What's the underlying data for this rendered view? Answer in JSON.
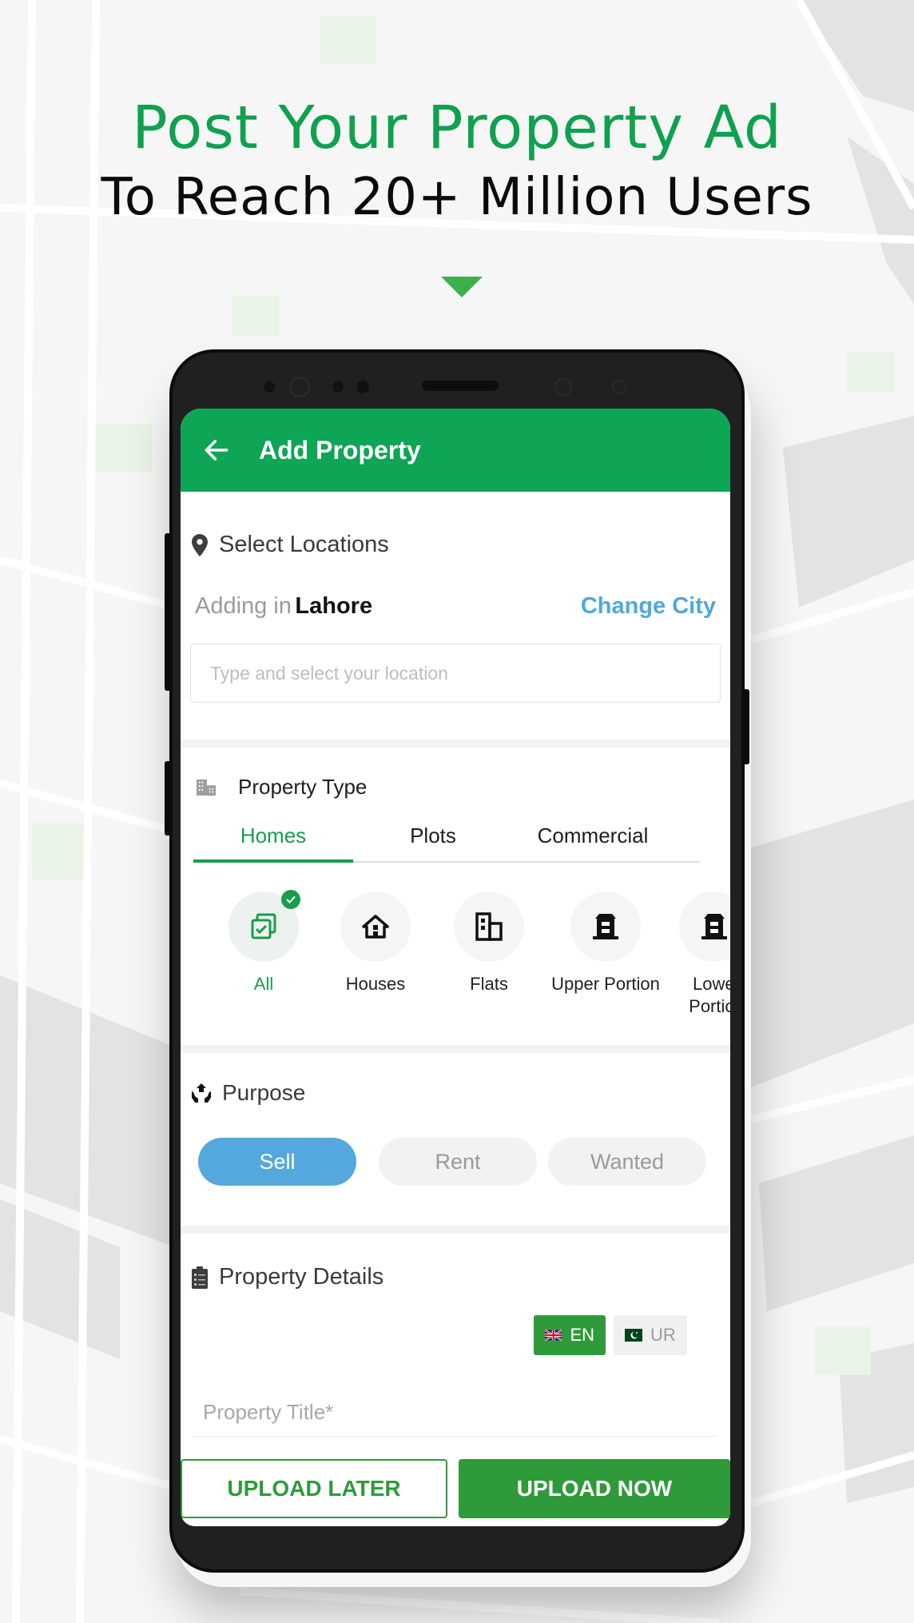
{
  "promo": {
    "headline_line1": "Post Your Property Ad",
    "headline_line2": "To Reach 20+ Million Users",
    "accent_color": "#0fa14f"
  },
  "app": {
    "title": "Add Property",
    "back_icon": "arrow-left-icon",
    "header_color": "#0fa556"
  },
  "location": {
    "heading": "Select Locations",
    "heading_icon": "map-pin-icon",
    "adding_label": "Adding in",
    "city": "Lahore",
    "change_city_label": "Change City",
    "input_placeholder": "Type and select your location",
    "input_value": ""
  },
  "property_type": {
    "heading": "Property Type",
    "heading_icon": "building-icon",
    "tabs": [
      {
        "label": "Homes",
        "active": true
      },
      {
        "label": "Plots",
        "active": false
      },
      {
        "label": "Commercial",
        "active": false
      }
    ],
    "types": [
      {
        "label": "All",
        "icon": "all-checkbox-icon",
        "selected": true
      },
      {
        "label": "Houses",
        "icon": "house-icon",
        "selected": false
      },
      {
        "label": "Flats",
        "icon": "flats-building-icon",
        "selected": false
      },
      {
        "label": "Upper Portion",
        "icon": "upper-portion-icon",
        "selected": false
      },
      {
        "label": "Lower Portion",
        "icon": "lower-portion-icon",
        "selected": false
      }
    ]
  },
  "purpose": {
    "heading": "Purpose",
    "heading_icon": "hands-house-icon",
    "options": [
      {
        "label": "Sell",
        "active": true
      },
      {
        "label": "Rent",
        "active": false
      },
      {
        "label": "Wanted",
        "active": false
      }
    ],
    "active_color": "#55a8de"
  },
  "details": {
    "heading": "Property Details",
    "heading_icon": "clipboard-list-icon",
    "languages": [
      {
        "code": "EN",
        "flag": "uk-flag-icon",
        "active": true
      },
      {
        "code": "UR",
        "flag": "pakistan-flag-icon",
        "active": false
      }
    ],
    "title_field_label": "Property Title*",
    "title_field_value": ""
  },
  "actions": {
    "upload_later": "UPLOAD LATER",
    "upload_now": "UPLOAD NOW",
    "button_color": "#2f9a3a"
  }
}
